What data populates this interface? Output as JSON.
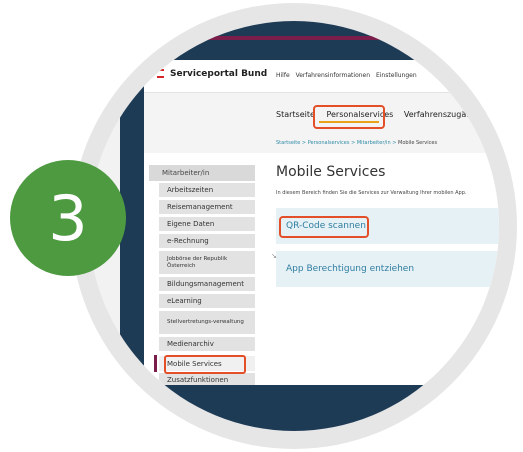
{
  "step_badge": "3",
  "brand": {
    "name": "Serviceportal Bund"
  },
  "topnav": [
    "Hilfe",
    "Verfahrensinformationen",
    "Einstellungen"
  ],
  "tabs": [
    "Startseite",
    "Personalservices",
    "Verfahrenszugänge"
  ],
  "active_tab": "Personalservices",
  "breadcrumb": [
    "Startseite",
    "Personalservices",
    "Mitarbeiter/in",
    "Mobile Services"
  ],
  "sidebar": {
    "title": "Mitarbeiter/in",
    "items": [
      "Arbeitszeiten",
      "Reisemanagement",
      "Eigene Daten",
      "e-Rechnung",
      "Jobbörse der Republik Österreich",
      "Bildungsmanagement",
      "eLearning",
      "Stellvertretungs-verwaltung",
      "Medienarchiv",
      "Mobile Services",
      "Zusatzfunktionen"
    ],
    "active": "Mobile Services"
  },
  "main": {
    "title": "Mobile Services",
    "description": "In diesem Bereich finden Sie die Services zur Verwaltung Ihrer mobilen App.",
    "actions": [
      "QR-Code scannen",
      "App Berechtigung entziehen"
    ]
  },
  "colors": {
    "highlight": "#e24f28",
    "badge": "#4e9a41",
    "navy": "#1e3b56",
    "link": "#2f7d9f"
  }
}
